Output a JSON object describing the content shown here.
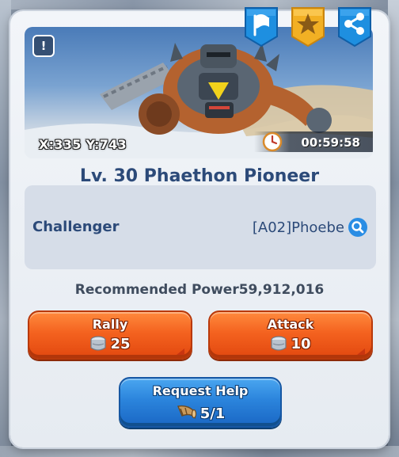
{
  "banner": {
    "alert_glyph": "!",
    "coords": "X:335 Y:743",
    "timer": "00:59:58",
    "icons": {
      "alert": "exclamation-icon",
      "timer": "clock-icon",
      "flag": "flag-icon",
      "favorite": "star-icon",
      "share": "share-icon"
    }
  },
  "boss": {
    "title": "Lv. 30 Phaethon Pioneer"
  },
  "info": {
    "challenger_label": "Challenger",
    "challenger_name": "[A02]Phoebe",
    "search_icon": "search-icon"
  },
  "recommended_power": "Recommended Power59,912,016",
  "buttons": {
    "rally": {
      "label": "Rally",
      "cost": "25",
      "icon": "stamina-can-icon"
    },
    "attack": {
      "label": "Attack",
      "cost": "10",
      "icon": "stamina-can-icon"
    },
    "request_help": {
      "label": "Request Help",
      "count": "5/1",
      "icon": "horn-icon"
    }
  },
  "colors": {
    "panel_bg": "#eef2f6",
    "title_blue": "#2c4a79",
    "orange_button": "#f4621f",
    "blue_button": "#2b84dc",
    "banner_button_blue": "#1e8fe0",
    "banner_button_gold": "#f2b024"
  }
}
